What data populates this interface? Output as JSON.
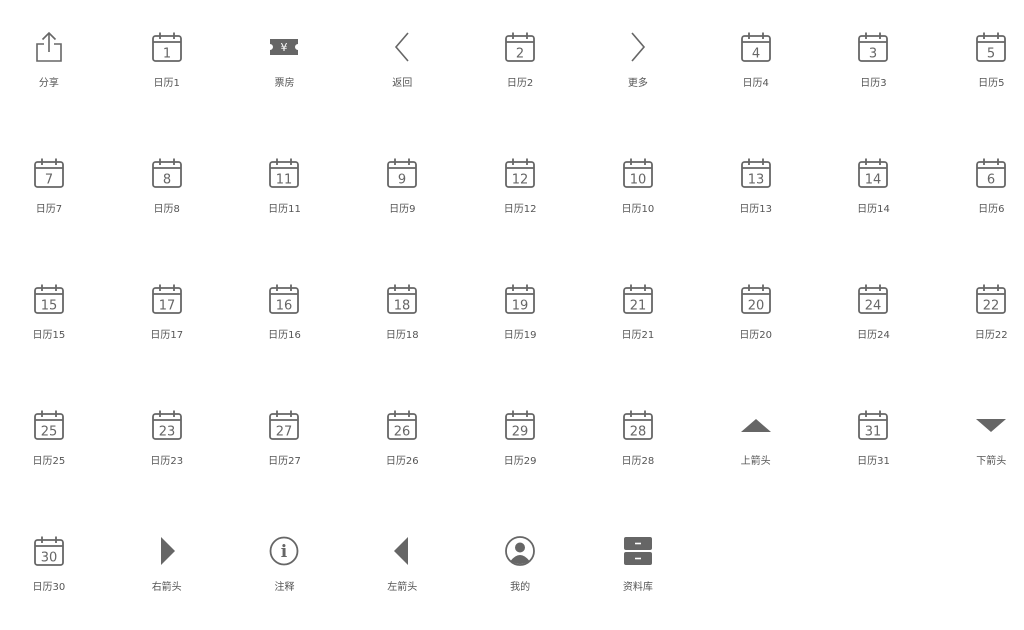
{
  "colors": {
    "icon": "#666666",
    "label": "#555555",
    "background": "#ffffff"
  },
  "icons": [
    {
      "kind": "share",
      "label": "分享",
      "icon_name": "share-icon"
    },
    {
      "kind": "calendar",
      "num": "1",
      "label": "日历1",
      "icon_name": "calendar-icon"
    },
    {
      "kind": "ticket",
      "glyph": "¥",
      "label": "票房",
      "icon_name": "ticket-icon"
    },
    {
      "kind": "chev-left",
      "label": "返回",
      "icon_name": "chevron-left-icon"
    },
    {
      "kind": "calendar",
      "num": "2",
      "label": "日历2",
      "icon_name": "calendar-icon"
    },
    {
      "kind": "chev-right",
      "label": "更多",
      "icon_name": "chevron-right-icon"
    },
    {
      "kind": "calendar",
      "num": "4",
      "label": "日历4",
      "icon_name": "calendar-icon"
    },
    {
      "kind": "calendar",
      "num": "3",
      "label": "日历3",
      "icon_name": "calendar-icon"
    },
    {
      "kind": "calendar",
      "num": "5",
      "label": "日历5",
      "icon_name": "calendar-icon"
    },
    {
      "kind": "calendar",
      "num": "7",
      "label": "日历7",
      "icon_name": "calendar-icon"
    },
    {
      "kind": "calendar",
      "num": "8",
      "label": "日历8",
      "icon_name": "calendar-icon"
    },
    {
      "kind": "calendar",
      "num": "11",
      "label": "日历11",
      "icon_name": "calendar-icon"
    },
    {
      "kind": "calendar",
      "num": "9",
      "label": "日历9",
      "icon_name": "calendar-icon"
    },
    {
      "kind": "calendar",
      "num": "12",
      "label": "日历12",
      "icon_name": "calendar-icon"
    },
    {
      "kind": "calendar",
      "num": "10",
      "label": "日历10",
      "icon_name": "calendar-icon"
    },
    {
      "kind": "calendar",
      "num": "13",
      "label": "日历13",
      "icon_name": "calendar-icon"
    },
    {
      "kind": "calendar",
      "num": "14",
      "label": "日历14",
      "icon_name": "calendar-icon"
    },
    {
      "kind": "calendar",
      "num": "6",
      "label": "日历6",
      "icon_name": "calendar-icon"
    },
    {
      "kind": "calendar",
      "num": "15",
      "label": "日历15",
      "icon_name": "calendar-icon"
    },
    {
      "kind": "calendar",
      "num": "17",
      "label": "日历17",
      "icon_name": "calendar-icon"
    },
    {
      "kind": "calendar",
      "num": "16",
      "label": "日历16",
      "icon_name": "calendar-icon"
    },
    {
      "kind": "calendar",
      "num": "18",
      "label": "日历18",
      "icon_name": "calendar-icon"
    },
    {
      "kind": "calendar",
      "num": "19",
      "label": "日历19",
      "icon_name": "calendar-icon"
    },
    {
      "kind": "calendar",
      "num": "21",
      "label": "日历21",
      "icon_name": "calendar-icon"
    },
    {
      "kind": "calendar",
      "num": "20",
      "label": "日历20",
      "icon_name": "calendar-icon"
    },
    {
      "kind": "calendar",
      "num": "24",
      "label": "日历24",
      "icon_name": "calendar-icon"
    },
    {
      "kind": "calendar",
      "num": "22",
      "label": "日历22",
      "icon_name": "calendar-icon"
    },
    {
      "kind": "calendar",
      "num": "25",
      "label": "日历25",
      "icon_name": "calendar-icon"
    },
    {
      "kind": "calendar",
      "num": "23",
      "label": "日历23",
      "icon_name": "calendar-icon"
    },
    {
      "kind": "calendar",
      "num": "27",
      "label": "日历27",
      "icon_name": "calendar-icon"
    },
    {
      "kind": "calendar",
      "num": "26",
      "label": "日历26",
      "icon_name": "calendar-icon"
    },
    {
      "kind": "calendar",
      "num": "29",
      "label": "日历29",
      "icon_name": "calendar-icon"
    },
    {
      "kind": "calendar",
      "num": "28",
      "label": "日历28",
      "icon_name": "calendar-icon"
    },
    {
      "kind": "tri-up",
      "label": "上箭头",
      "icon_name": "arrow-up-icon"
    },
    {
      "kind": "calendar",
      "num": "31",
      "label": "日历31",
      "icon_name": "calendar-icon"
    },
    {
      "kind": "tri-down",
      "label": "下箭头",
      "icon_name": "arrow-down-icon"
    },
    {
      "kind": "calendar",
      "num": "30",
      "label": "日历30",
      "icon_name": "calendar-icon"
    },
    {
      "kind": "tri-right",
      "label": "右箭头",
      "icon_name": "arrow-right-icon"
    },
    {
      "kind": "info",
      "glyph": "i",
      "label": "注释",
      "icon_name": "info-icon"
    },
    {
      "kind": "tri-left",
      "label": "左箭头",
      "icon_name": "arrow-left-icon"
    },
    {
      "kind": "user",
      "label": "我的",
      "icon_name": "user-icon"
    },
    {
      "kind": "archive",
      "label": "资料库",
      "icon_name": "archive-icon"
    }
  ]
}
